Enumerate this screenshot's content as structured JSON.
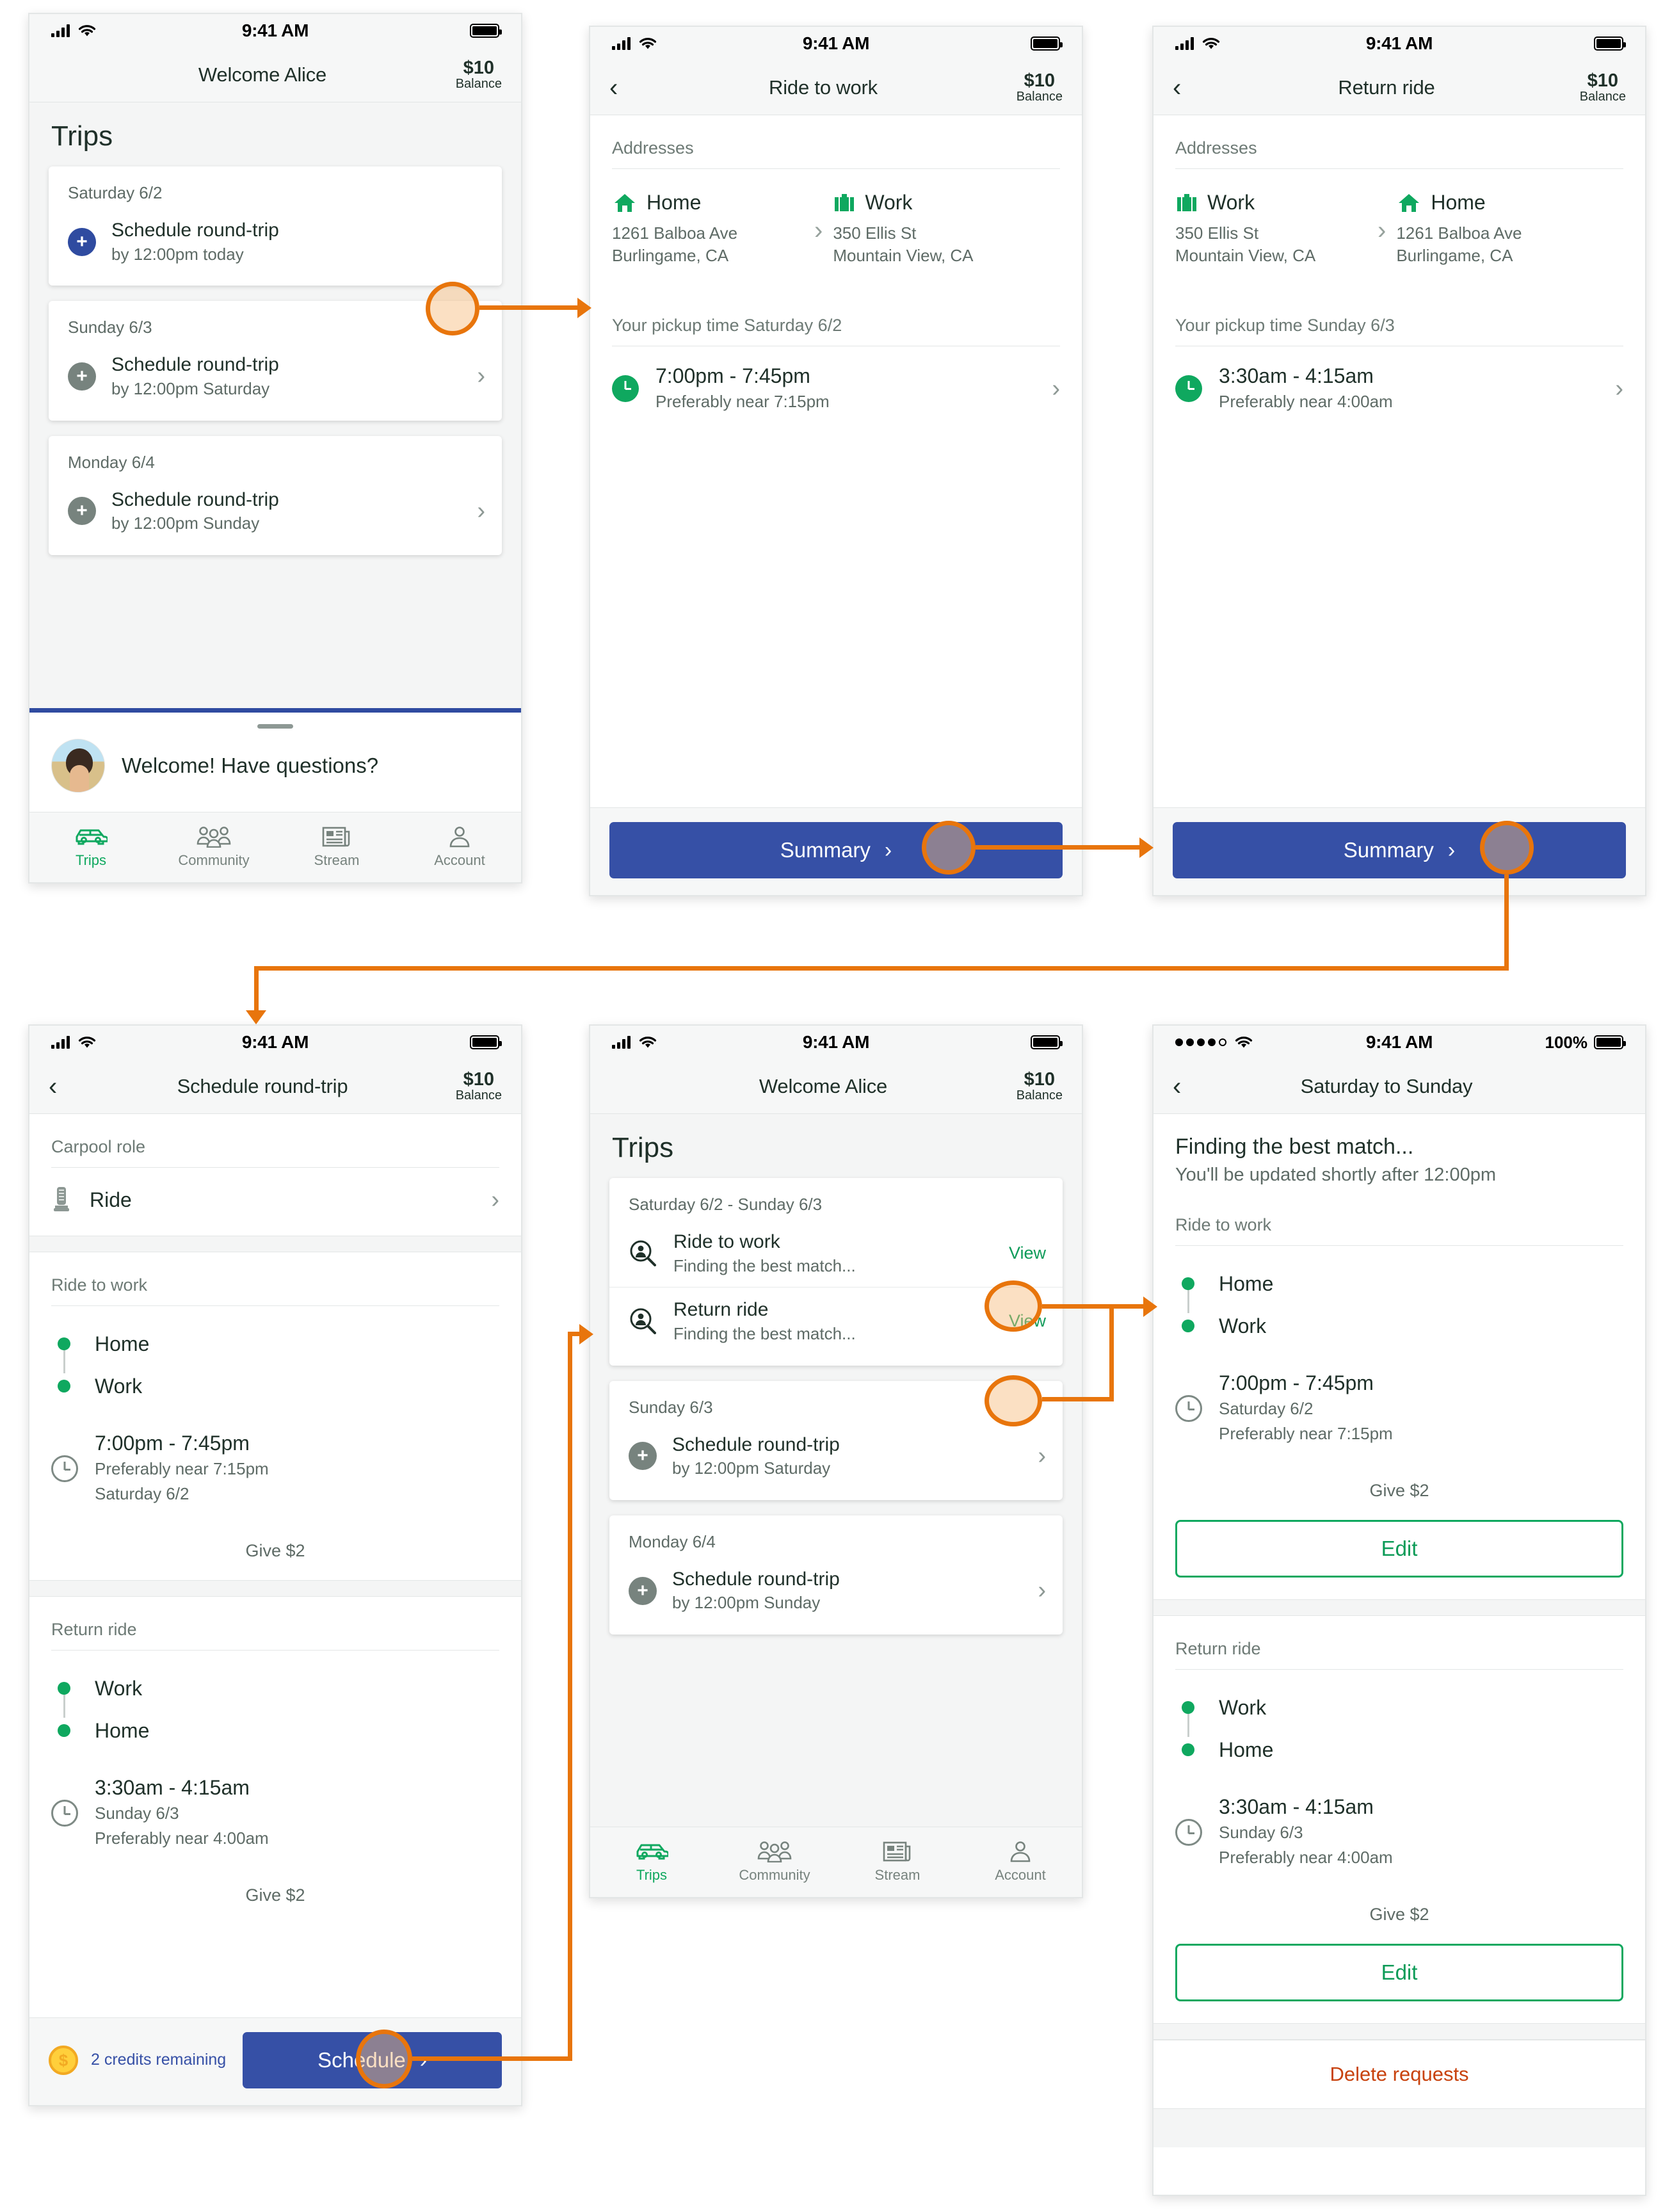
{
  "status_bar": {
    "time": "9:41 AM",
    "battery_percent": "100%"
  },
  "balance": {
    "amount": "$10",
    "label": "Balance"
  },
  "tabs": [
    {
      "label": "Trips",
      "icon": "car-icon",
      "active": true
    },
    {
      "label": "Community",
      "icon": "people-icon",
      "active": false
    },
    {
      "label": "Stream",
      "icon": "newspaper-icon",
      "active": false
    },
    {
      "label": "Account",
      "icon": "person-icon",
      "active": false
    }
  ],
  "screen1": {
    "nav_title": "Welcome Alice",
    "page_title": "Trips",
    "cards": [
      {
        "date": "Saturday 6/2",
        "title": "Schedule round-trip",
        "sub": "by 12:00pm today",
        "badge": "plus-icon",
        "badge_color": "#2f4ba0"
      },
      {
        "date": "Sunday 6/3",
        "title": "Schedule round-trip",
        "sub": "by 12:00pm Saturday",
        "badge": "plus-icon",
        "badge_color": "#77837e"
      },
      {
        "date": "Monday 6/4",
        "title": "Schedule round-trip",
        "sub": "by 12:00pm Sunday",
        "badge": "plus-icon",
        "badge_color": "#77837e"
      }
    ],
    "support": {
      "message": "Welcome! Have questions?"
    }
  },
  "screen2": {
    "nav_title": "Ride to work",
    "addresses_label": "Addresses",
    "from": {
      "icon": "home-icon",
      "name": "Home",
      "line1": "1261 Balboa Ave",
      "line2": "Burlingame, CA"
    },
    "to": {
      "icon": "briefcase-icon",
      "name": "Work",
      "line1": "350 Ellis St",
      "line2": "Mountain View, CA"
    },
    "pickup_label": "Your pickup time Saturday 6/2",
    "time": {
      "range": "7:00pm - 7:45pm",
      "preference": "Preferably near 7:15pm"
    },
    "cta": "Summary"
  },
  "screen3": {
    "nav_title": "Return ride",
    "addresses_label": "Addresses",
    "from": {
      "icon": "briefcase-icon",
      "name": "Work",
      "line1": "350 Ellis St",
      "line2": "Mountain View, CA"
    },
    "to": {
      "icon": "home-icon",
      "name": "Home",
      "line1": "1261 Balboa Ave",
      "line2": "Burlingame, CA"
    },
    "pickup_label": "Your pickup time Sunday 6/3",
    "time": {
      "range": "3:30am - 4:15am",
      "preference": "Preferably near 4:00am"
    },
    "cta": "Summary"
  },
  "screen4": {
    "nav_title": "Schedule round-trip",
    "carpool_label": "Carpool role",
    "role": {
      "icon": "seat-icon",
      "value": "Ride"
    },
    "leg1": {
      "label": "Ride to work",
      "stops": [
        "Home",
        "Work"
      ],
      "time": "7:00pm - 7:45pm",
      "detail1": "Preferably near 7:15pm",
      "detail2": "Saturday 6/2",
      "give": "Give $2"
    },
    "leg2": {
      "label": "Return ride",
      "stops": [
        "Work",
        "Home"
      ],
      "time": "3:30am - 4:15am",
      "detail1": "Sunday 6/3",
      "detail2": "Preferably near 4:00am",
      "give": "Give $2"
    },
    "credits": "2 credits remaining",
    "cta": "Schedule"
  },
  "screen5": {
    "nav_title": "Welcome Alice",
    "page_title": "Trips",
    "scheduled_card": {
      "date": "Saturday 6/2 - Sunday 6/3",
      "rows": [
        {
          "title": "Ride to work",
          "sub": "Finding the best match...",
          "action": "View",
          "icon": "search-person-icon"
        },
        {
          "title": "Return ride",
          "sub": "Finding the best match...",
          "action": "View",
          "icon": "search-person-icon"
        }
      ]
    },
    "cards": [
      {
        "date": "Sunday 6/3",
        "title": "Schedule round-trip",
        "sub": "by 12:00pm Saturday",
        "badge": "plus-icon"
      },
      {
        "date": "Monday 6/4",
        "title": "Schedule round-trip",
        "sub": "by 12:00pm Sunday",
        "badge": "plus-icon"
      }
    ]
  },
  "screen6": {
    "nav_title": "Saturday to Sunday",
    "status_title": "Finding the best match...",
    "status_sub": "You'll be updated shortly after 12:00pm",
    "leg1": {
      "label": "Ride to work",
      "stops": [
        "Home",
        "Work"
      ],
      "time": "7:00pm - 7:45pm",
      "detail1": "Saturday 6/2",
      "detail2": "Preferably near 7:15pm",
      "give": "Give $2",
      "edit": "Edit"
    },
    "leg2": {
      "label": "Return ride",
      "stops": [
        "Work",
        "Home"
      ],
      "time": "3:30am - 4:15am",
      "detail1": "Sunday 6/3",
      "detail2": "Preferably near 4:00am",
      "give": "Give $2",
      "edit": "Edit"
    },
    "delete": "Delete requests"
  },
  "colors": {
    "accent_green": "#0fa85f",
    "primary_blue": "#3650a6",
    "flow_orange": "#e8750c",
    "danger_red": "#c8420d"
  }
}
